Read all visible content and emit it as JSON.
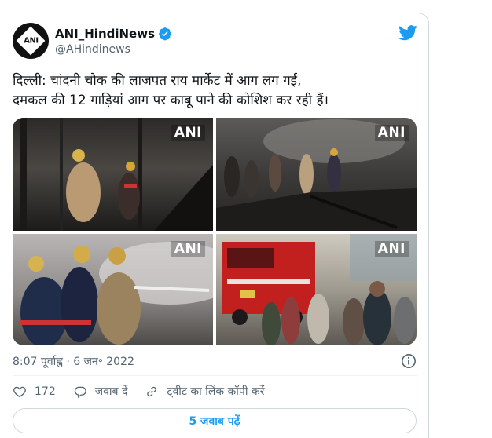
{
  "author": {
    "display_name": "ANI_HindiNews",
    "handle": "@AHindinews",
    "avatar_text": "ANI"
  },
  "tweet": {
    "text": "दिल्ली: चांदनी चौक की लाजपत राय मार्केट में आग लग गई,\nदमकल की 12 गाड़ियां आग पर काबू पाने की कोशिश कर रही हैं।",
    "watermarks": [
      "ANI",
      "ANI",
      "ANI",
      "ANI"
    ],
    "timestamp": "8:07 पूर्वाह्न · 6 जन॰ 2022"
  },
  "actions": {
    "like_count": "172",
    "reply_label": "जवाब दें",
    "copy_link_label": "ट्वीट का लिंक कॉपी करें"
  },
  "read_replies_label": "5 जवाब पढ़ें",
  "colors": {
    "accent": "#1d9bf0",
    "secondary_text": "#536471",
    "border": "#cfd9de"
  },
  "icons": [
    "verified-badge-icon",
    "twitter-bird-icon",
    "info-icon",
    "heart-icon",
    "reply-icon",
    "link-icon"
  ]
}
